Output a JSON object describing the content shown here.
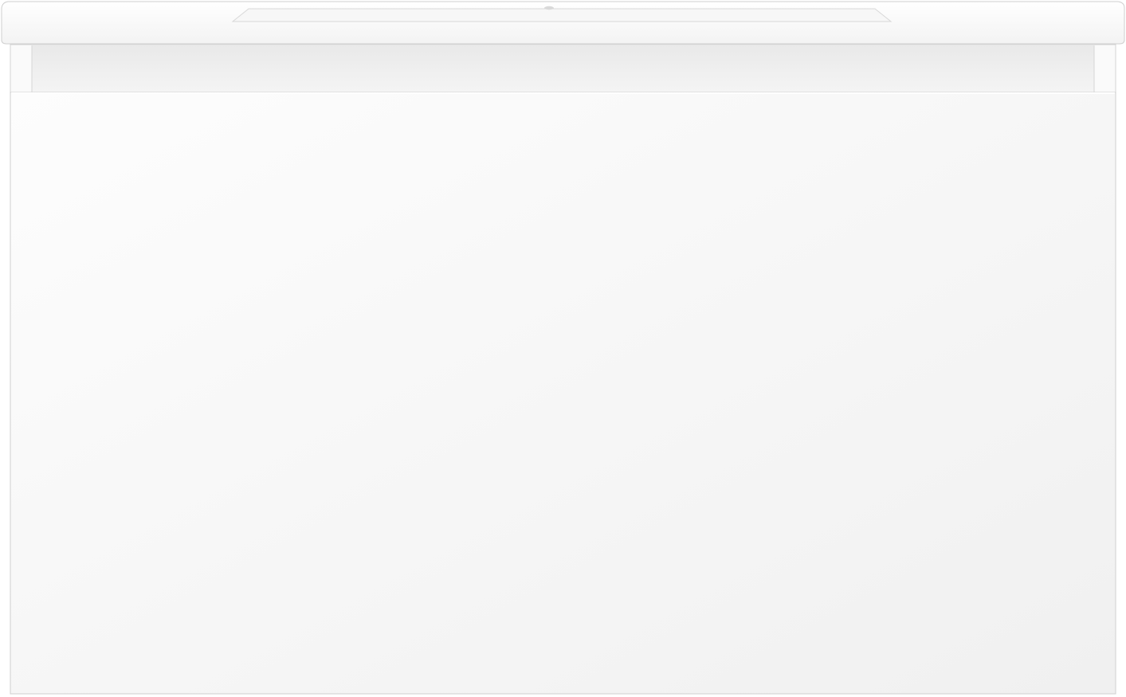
{
  "image": {
    "subject": "vanity-unit-front-view",
    "colors": {
      "background": "#ffffff",
      "basin_top": "#fbfbfb",
      "basin_edge": "#e8e8e8",
      "outline": "#cfcfcf",
      "carcass_recess": "#eeeeee",
      "drawer_front_light": "#fcfcfc",
      "drawer_front_dark": "#f1f1f1"
    },
    "icons": [
      "tap-hole"
    ]
  }
}
